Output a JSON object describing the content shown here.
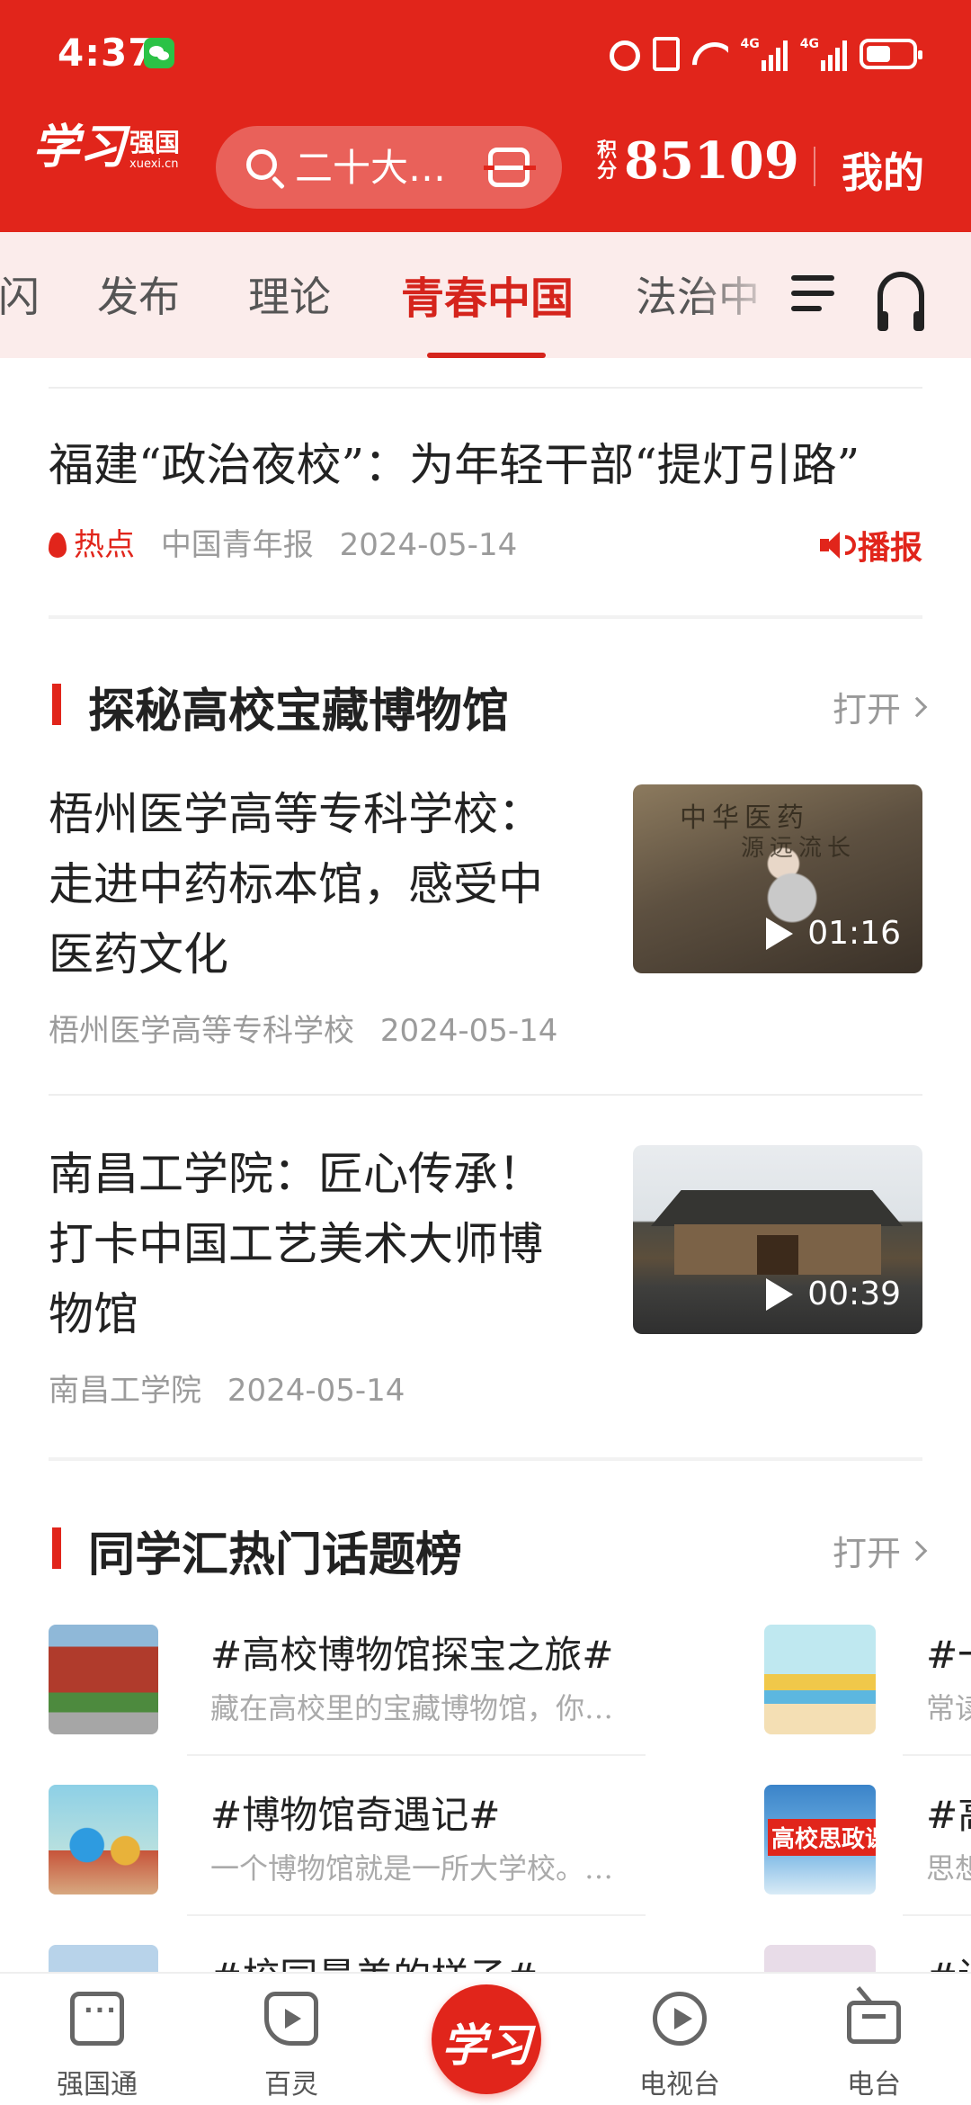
{
  "status_bar": {
    "time": "4:37",
    "net_label_1": "4G",
    "net_label_2": "4G",
    "battery_level": 0.55
  },
  "header": {
    "logo_script": "学习",
    "logo_name": "强国",
    "logo_domain": "xuexi.cn",
    "search_placeholder": "二十大…",
    "points_label": "积分",
    "points_value": "85109",
    "mine_label": "我的"
  },
  "tabs": {
    "items": [
      "闪",
      "发布",
      "理论",
      "青春中国",
      "法治中"
    ],
    "active_index": 3
  },
  "top_article": {
    "title": "福建“政治夜校”：为年轻干部“提灯引路”",
    "hot_label": "热点",
    "source": "中国青年报",
    "date": "2024-05-14",
    "broadcast_label": "播报"
  },
  "section_museum": {
    "title": "探秘高校宝藏博物馆",
    "open_label": "打开",
    "articles": [
      {
        "title_lines": [
          "梧州医学高等专科学校：",
          "走进中药标本馆，感受中",
          "医药文化"
        ],
        "source": "梧州医学高等专科学校",
        "date": "2024-05-14",
        "duration": "01:16",
        "thumb_text_1": "中华医药",
        "thumb_text_2": "源远流长"
      },
      {
        "title_lines": [
          "南昌工学院：匠心传承！",
          "打卡中国工艺美术大师博",
          "物馆"
        ],
        "source": "南昌工学院",
        "date": "2024-05-14",
        "duration": "00:39"
      }
    ]
  },
  "section_topics": {
    "title": "同学汇热门话题榜",
    "open_label": "打开",
    "left_column": [
      {
        "title": "#高校博物馆探宝之旅#",
        "desc": "藏在高校里的宝藏博物馆，你…"
      },
      {
        "title": "#博物馆奇遇记#",
        "desc": "一个博物馆就是一所大学校。…"
      },
      {
        "title": "#校园最美的样子#",
        "desc": ""
      }
    ],
    "right_column": [
      {
        "title": "#一",
        "desc": "常读"
      },
      {
        "title": "#高",
        "desc": "思想",
        "image_tag": "高校思政课"
      },
      {
        "title": "#读",
        "desc": ""
      }
    ]
  },
  "bottom_nav": {
    "items": [
      "强国通",
      "百灵",
      "电视台",
      "电台"
    ],
    "center_label": "学习"
  }
}
